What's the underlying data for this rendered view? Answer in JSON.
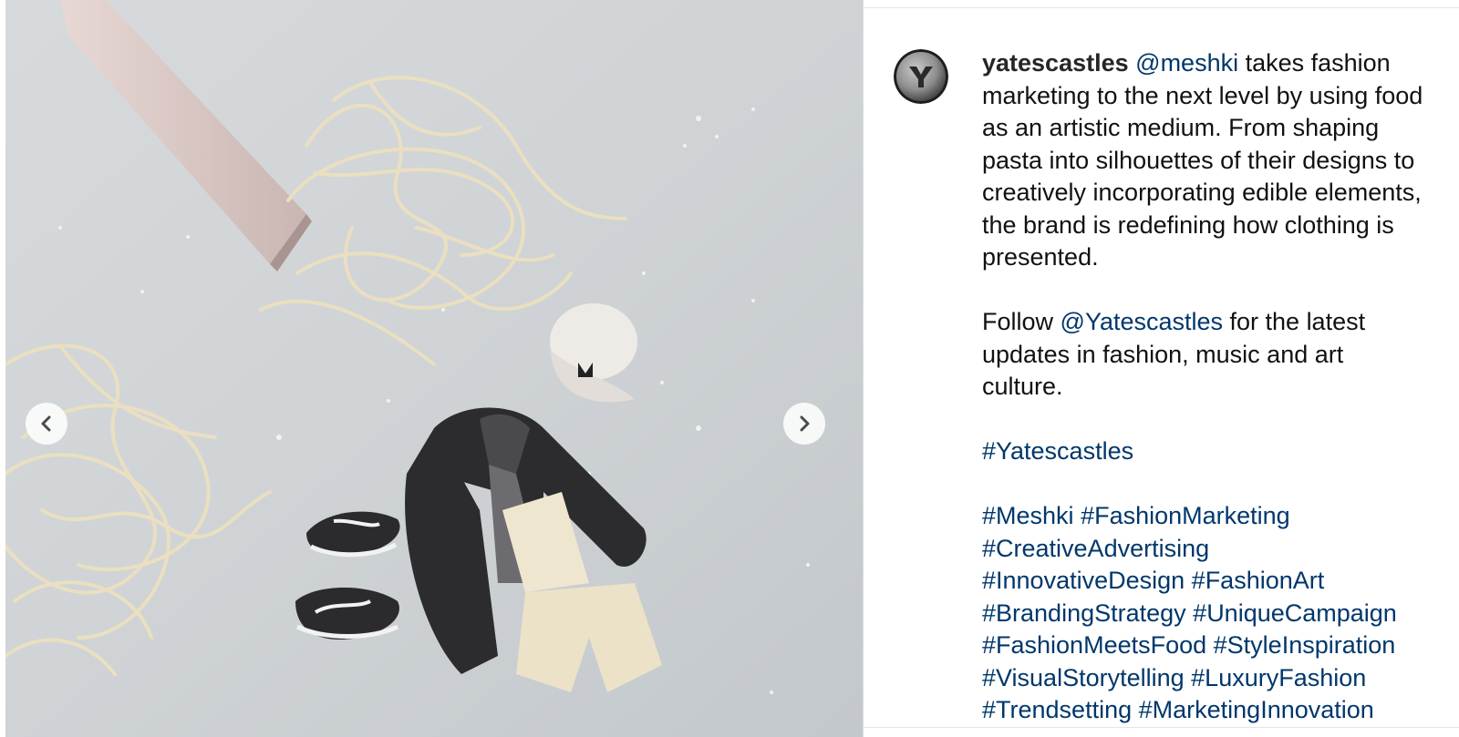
{
  "post": {
    "username": "yatescastles",
    "avatar_icon": "yatescastles-logo",
    "caption": {
      "mention": "@meshki",
      "text": " takes fashion marketing to the next level by using food as an artistic medium. From shaping pasta into silhouettes of their designs to creatively incorporating edible elements, the brand is redefining how clothing is presented.",
      "follow_prefix": "Follow ",
      "follow_mention": "@Yatescastles",
      "follow_suffix": " for the latest updates in fashion, music and art culture.",
      "primary_hashtag": "#Yatescastles",
      "hashtags": [
        "#Meshki",
        "#FashionMarketing",
        "#CreativeAdvertising",
        "#InnovativeDesign",
        "#FashionArt",
        "#BrandingStrategy",
        "#UniqueCampaign",
        "#FashionMeetsFood",
        "#StyleInspiration",
        "#VisualStorytelling",
        "#LuxuryFashion",
        "#Trendsetting",
        "#MarketingInnovation"
      ]
    }
  },
  "media": {
    "prev_icon": "chevron-left-icon",
    "next_icon": "chevron-right-icon",
    "subject": "Miniature pasta outfit: cap, jacket, shorts and sneakers on floured surface"
  },
  "colors": {
    "link": "#00376b",
    "text": "#111111",
    "username": "#262626"
  }
}
